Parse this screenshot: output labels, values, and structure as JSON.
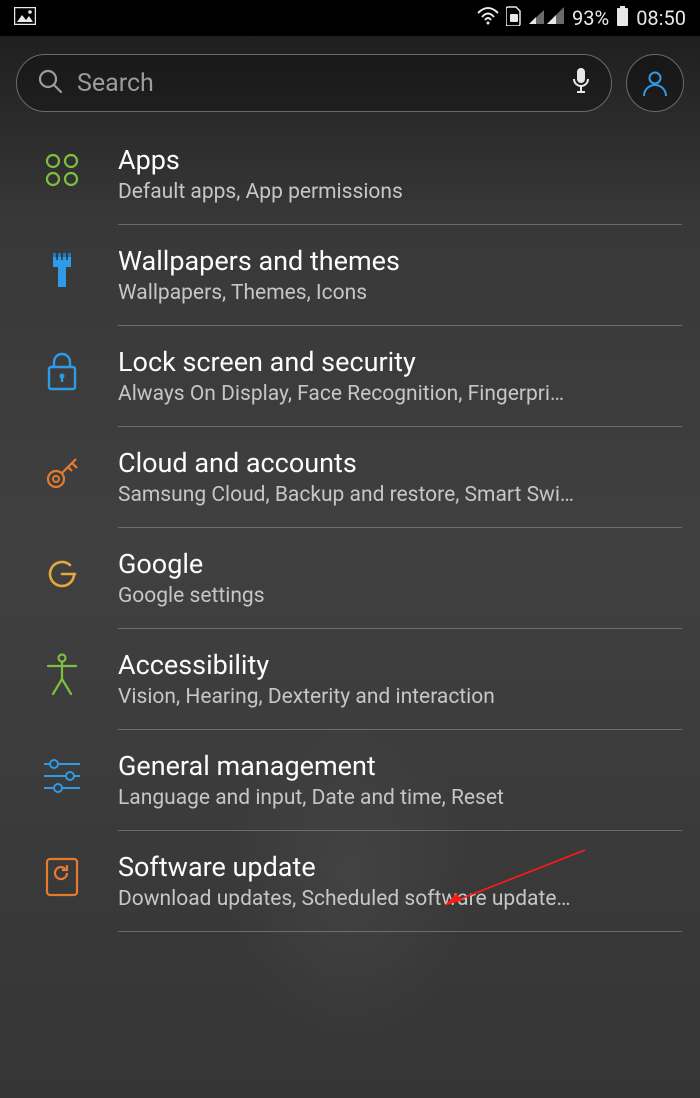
{
  "status": {
    "battery_pct": "93%",
    "time": "08:50"
  },
  "search": {
    "placeholder": "Search"
  },
  "items": [
    {
      "id": "apps",
      "title": "Apps",
      "sub": "Default apps, App permissions"
    },
    {
      "id": "wallpaper",
      "title": "Wallpapers and themes",
      "sub": "Wallpapers, Themes, Icons"
    },
    {
      "id": "lock",
      "title": "Lock screen and security",
      "sub": "Always On Display, Face Recognition, Fingerpri…"
    },
    {
      "id": "cloud",
      "title": "Cloud and accounts",
      "sub": "Samsung Cloud, Backup and restore, Smart Swi…"
    },
    {
      "id": "google",
      "title": "Google",
      "sub": "Google settings"
    },
    {
      "id": "access",
      "title": "Accessibility",
      "sub": "Vision, Hearing, Dexterity and interaction"
    },
    {
      "id": "general",
      "title": "General management",
      "sub": "Language and input, Date and time, Reset"
    },
    {
      "id": "update",
      "title": "Software update",
      "sub": "Download updates, Scheduled software update…"
    }
  ],
  "colors": {
    "apps": "#7fbf3f",
    "brush": "#2f9be6",
    "lock": "#2f9be6",
    "key": "#e67a2f",
    "google": "#e6a83a",
    "access": "#7fbf3f",
    "sliders": "#2f9be6",
    "update": "#e67a2f",
    "profile": "#2f9be6"
  }
}
